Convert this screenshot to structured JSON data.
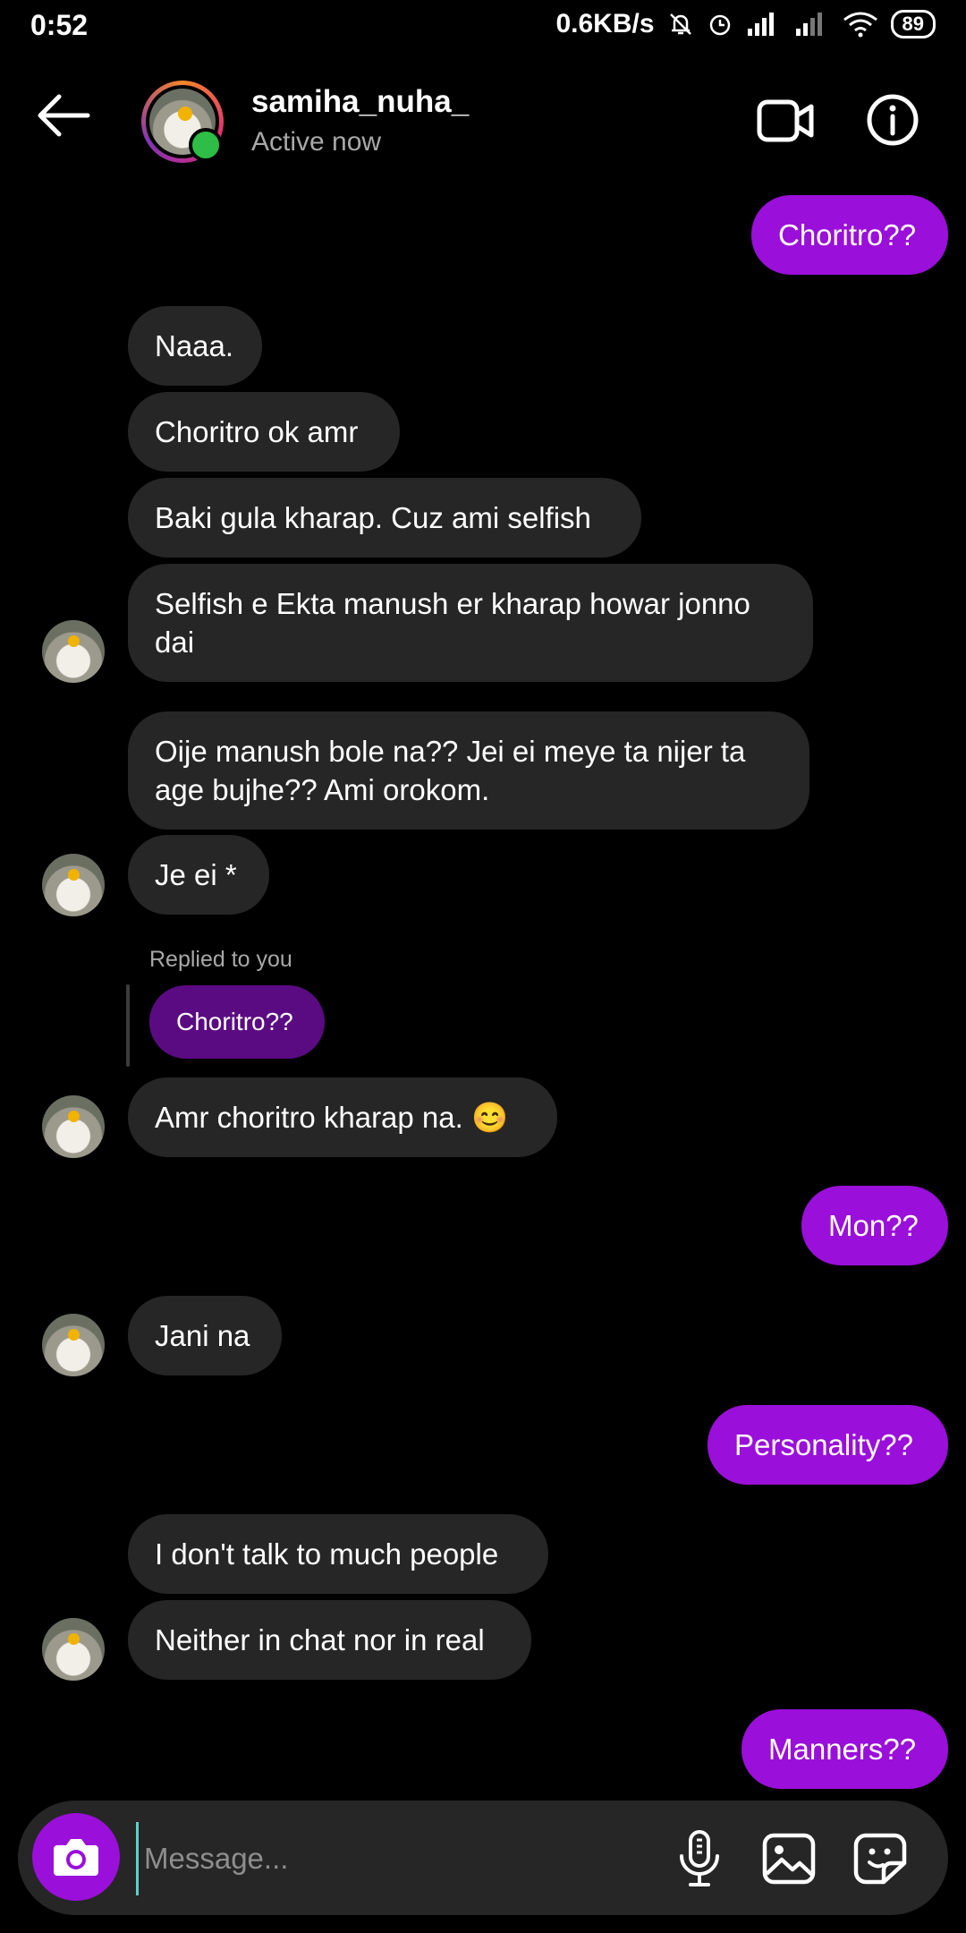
{
  "status_bar": {
    "time": "0:52",
    "speed": "0.6KB/s",
    "battery": "89"
  },
  "header": {
    "username": "samiha_nuha_",
    "status": "Active now"
  },
  "messages": [
    {
      "text": "Choritro??"
    },
    {
      "text": "Naaa."
    },
    {
      "text": "Choritro ok amr"
    },
    {
      "text": "Baki gula kharap. Cuz ami selfish"
    },
    {
      "text": "Selfish e Ekta manush er kharap howar jonno dai"
    },
    {
      "text": "Oije manush bole na?? Jei ei meye ta nijer ta age bujhe?? Ami orokom."
    },
    {
      "text": "Je ei *"
    },
    {
      "text": "Amr choritro kharap na. 😊"
    },
    {
      "text": "Mon??"
    },
    {
      "text": "Jani na"
    },
    {
      "text": "Personality??"
    },
    {
      "text": "I don't talk to much people"
    },
    {
      "text": "Neither in chat nor in real"
    },
    {
      "text": "Manners??"
    }
  ],
  "reply": {
    "label": "Replied to you",
    "quoted": "Choritro??"
  },
  "composer": {
    "placeholder": "Message..."
  },
  "colors": {
    "outgoing_bubble": "#9a0fd9",
    "incoming_bubble": "#262626",
    "online": "#2ebd46"
  }
}
